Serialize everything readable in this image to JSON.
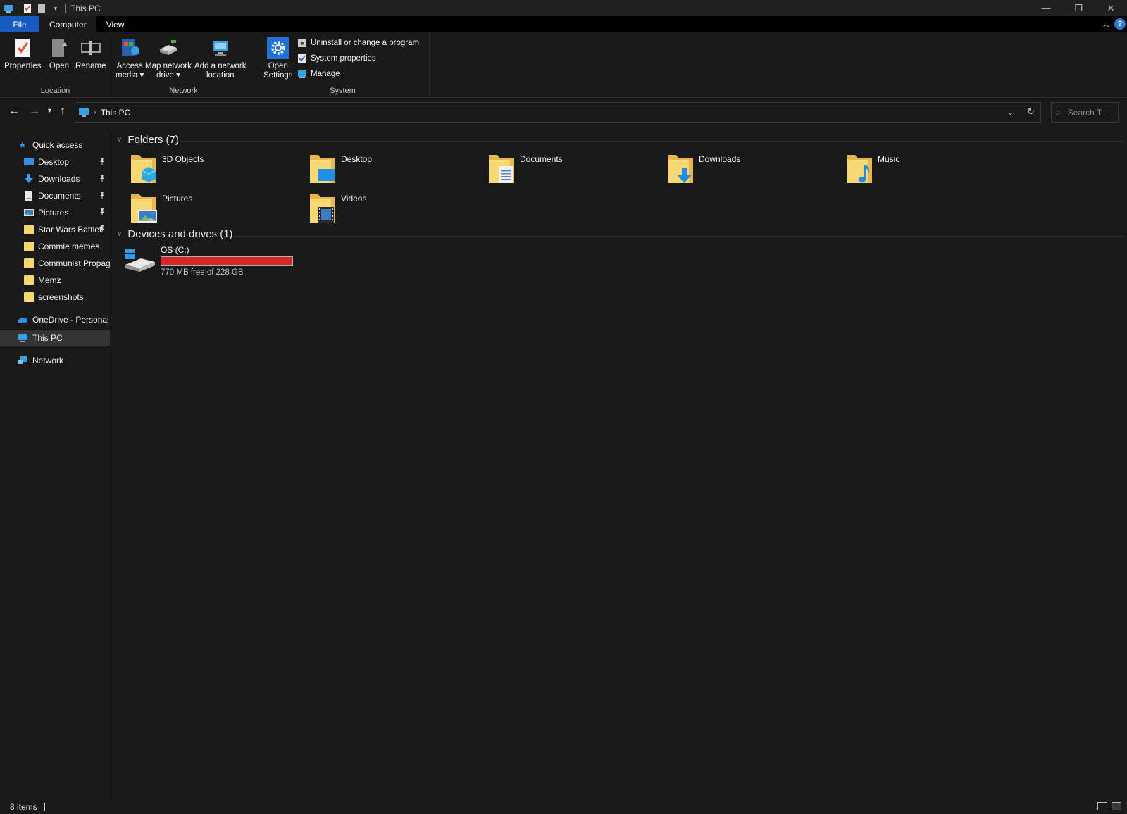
{
  "window": {
    "title": "This PC"
  },
  "tabs": [
    {
      "label": "File"
    },
    {
      "label": "Computer"
    },
    {
      "label": "View"
    }
  ],
  "ribbon": {
    "groups": {
      "location": "Location",
      "network": "Network",
      "system": "System"
    },
    "buttons": {
      "properties": "Properties",
      "open": "Open",
      "rename": "Rename",
      "access_media_1": "Access",
      "access_media_2": "media",
      "map_drive_1": "Map network",
      "map_drive_2": "drive",
      "add_location_1": "Add a network",
      "add_location_2": "location",
      "open_settings_1": "Open",
      "open_settings_2": "Settings",
      "uninstall": "Uninstall or change a program",
      "system_properties": "System properties",
      "manage": "Manage"
    }
  },
  "address": {
    "crumb": "This PC",
    "search_placeholder": "Search T..."
  },
  "sidebar": {
    "quick_access": "Quick access",
    "pinned": [
      {
        "label": "Desktop"
      },
      {
        "label": "Downloads"
      },
      {
        "label": "Documents"
      },
      {
        "label": "Pictures"
      },
      {
        "label": "Star Wars Battlef"
      }
    ],
    "recent": [
      {
        "label": "Commie memes"
      },
      {
        "label": "Communist Propag"
      },
      {
        "label": "Memz"
      },
      {
        "label": "screenshots"
      }
    ],
    "onedrive": "OneDrive - Personal",
    "this_pc": "This PC",
    "network": "Network"
  },
  "content": {
    "folders_header": "Folders (7)",
    "folders": [
      {
        "name": "3D Objects"
      },
      {
        "name": "Desktop"
      },
      {
        "name": "Documents"
      },
      {
        "name": "Downloads"
      },
      {
        "name": "Music"
      },
      {
        "name": "Pictures"
      },
      {
        "name": "Videos"
      }
    ],
    "devices_header": "Devices and drives (1)",
    "drive": {
      "name": "OS (C:)",
      "free_text": "770 MB free of 228 GB",
      "used_fraction": 0.9967
    }
  },
  "status": {
    "items": "8 items"
  },
  "colors": {
    "accent": "#195abf",
    "drive_full": "#da2626",
    "folder": "#f6d66f"
  },
  "icons": {
    "nav_back": "arrow-left-icon",
    "nav_forward": "arrow-right-icon",
    "nav_up": "arrow-up-icon"
  }
}
